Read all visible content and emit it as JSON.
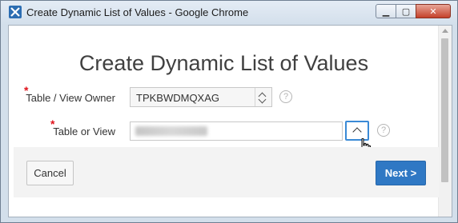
{
  "window": {
    "title": "Create Dynamic List of Values - Google Chrome",
    "controls": {
      "minimize": "▁",
      "maximize": "▢",
      "close": "✕"
    }
  },
  "dialog": {
    "title": "Create Dynamic List of Values",
    "required_marker": "*",
    "fields": {
      "owner": {
        "label": "Table / View Owner",
        "value": "TPKBWDMQXAG",
        "help": "?"
      },
      "table": {
        "label": "Table or View",
        "value": "",
        "help": "?"
      }
    },
    "buttons": {
      "cancel": "Cancel",
      "next": "Next >"
    }
  },
  "colors": {
    "accent": "#2f78c4",
    "required": "#e0121b",
    "focus_border": "#3a8ad6"
  }
}
